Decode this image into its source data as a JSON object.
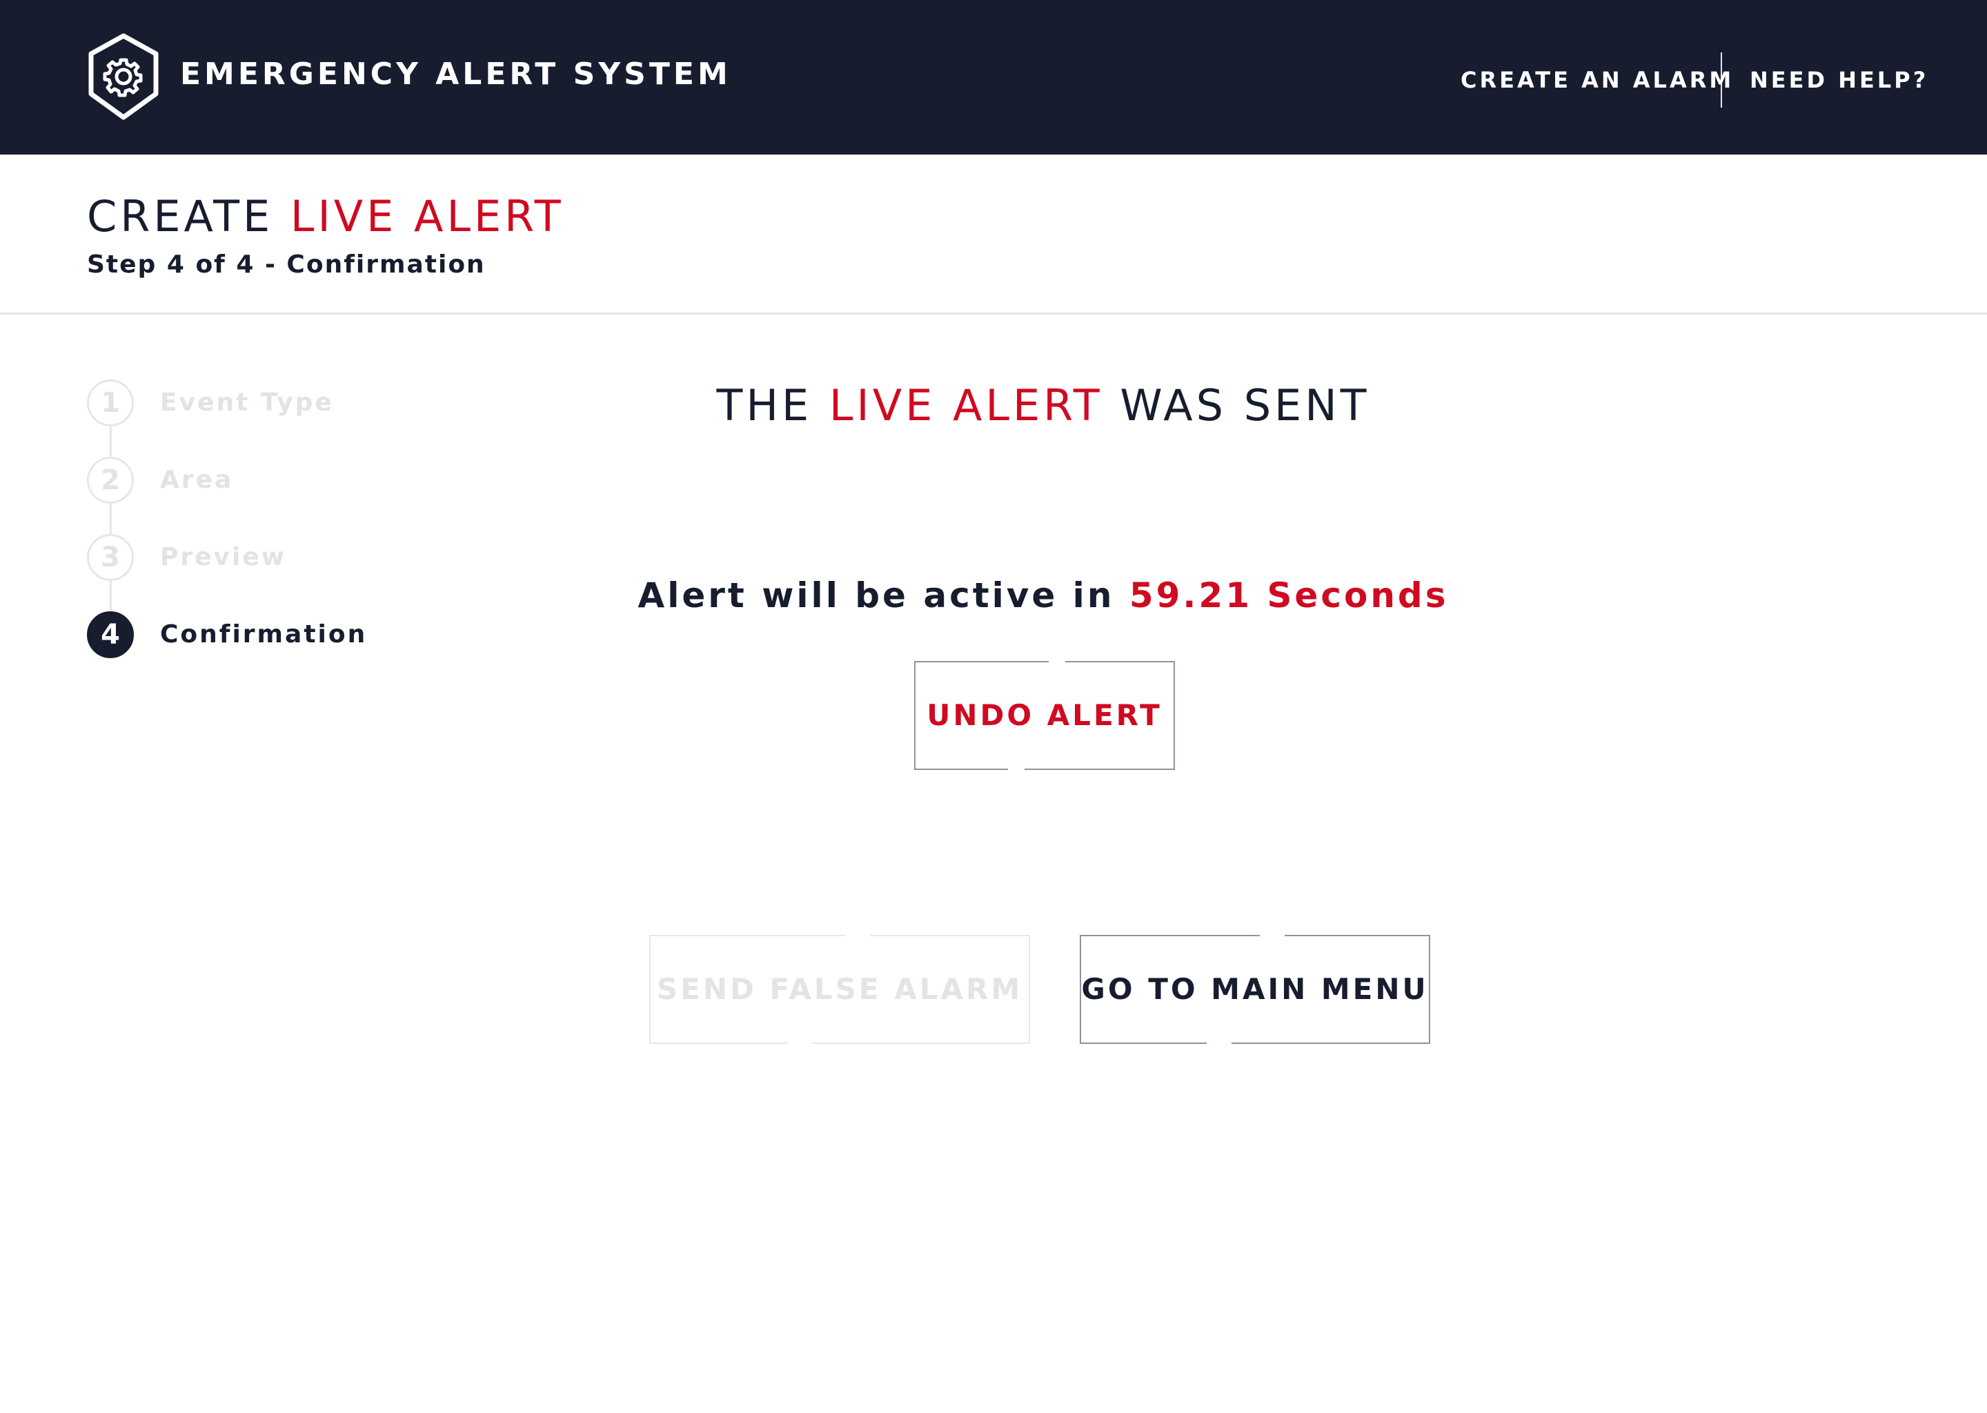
{
  "header": {
    "app_title": "EMERGENCY ALERT SYSTEM",
    "logo_icon": "shield-gear-icon",
    "nav": {
      "create_alarm": "CREATE AN ALARM",
      "need_help": "NEED HELP?"
    }
  },
  "page": {
    "title_prefix": "CREATE",
    "title_highlight": "LIVE ALERT",
    "step_text": "Step 4 of 4 - Confirmation"
  },
  "steps": [
    {
      "number": "1",
      "label": "Event Type",
      "state": "completed"
    },
    {
      "number": "2",
      "label": "Area",
      "state": "completed"
    },
    {
      "number": "3",
      "label": "Preview",
      "state": "completed"
    },
    {
      "number": "4",
      "label": "Confirmation",
      "state": "active"
    }
  ],
  "confirmation": {
    "title_prefix": "THE",
    "title_highlight": "LIVE ALERT",
    "title_suffix": "WAS SENT",
    "countdown_prefix": "Alert will be active in",
    "countdown_value": "59.21 Seconds",
    "undo_label": "UNDO ALERT",
    "false_alarm_label": "SEND FALSE ALARM",
    "main_menu_label": "GO TO MAIN MENU"
  },
  "colors": {
    "navy": "#171d2f",
    "accent_red": "#cf0a21",
    "disabled": "#e3e4e7",
    "border": "#8f929b"
  }
}
